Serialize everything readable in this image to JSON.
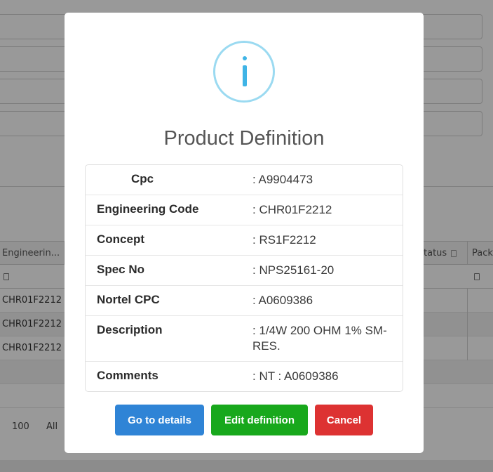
{
  "background": {
    "columns": [
      {
        "label": "Engineerin..."
      },
      {
        "label": "tatus"
      },
      {
        "label": "Packa"
      }
    ],
    "rows": [
      {
        "engineering_code": "CHR01F2212"
      },
      {
        "engineering_code": "CHR01F2212"
      },
      {
        "engineering_code": "CHR01F2212"
      }
    ],
    "pager": {
      "size_100": "100",
      "size_all": "All"
    }
  },
  "modal": {
    "icon": "info-icon",
    "title": "Product Definition",
    "fields": [
      {
        "label": "Cpc",
        "value": ": A9904473"
      },
      {
        "label": "Engineering Code",
        "value": ": CHR01F2212"
      },
      {
        "label": "Concept",
        "value": ": RS1F2212"
      },
      {
        "label": "Spec No",
        "value": ": NPS25161-20"
      },
      {
        "label": "Nortel CPC",
        "value": ": A0609386"
      },
      {
        "label": "Description",
        "value": ": 1/4W 200 OHM 1% SM-RES."
      },
      {
        "label": "Comments",
        "value": ": NT : A0609386"
      }
    ],
    "buttons": {
      "details": "Go to details",
      "edit": "Edit definition",
      "cancel": "Cancel"
    },
    "colors": {
      "details": "#2f84d6",
      "edit": "#18a81c",
      "cancel": "#dd3232",
      "info": "#3fb4e6"
    }
  }
}
